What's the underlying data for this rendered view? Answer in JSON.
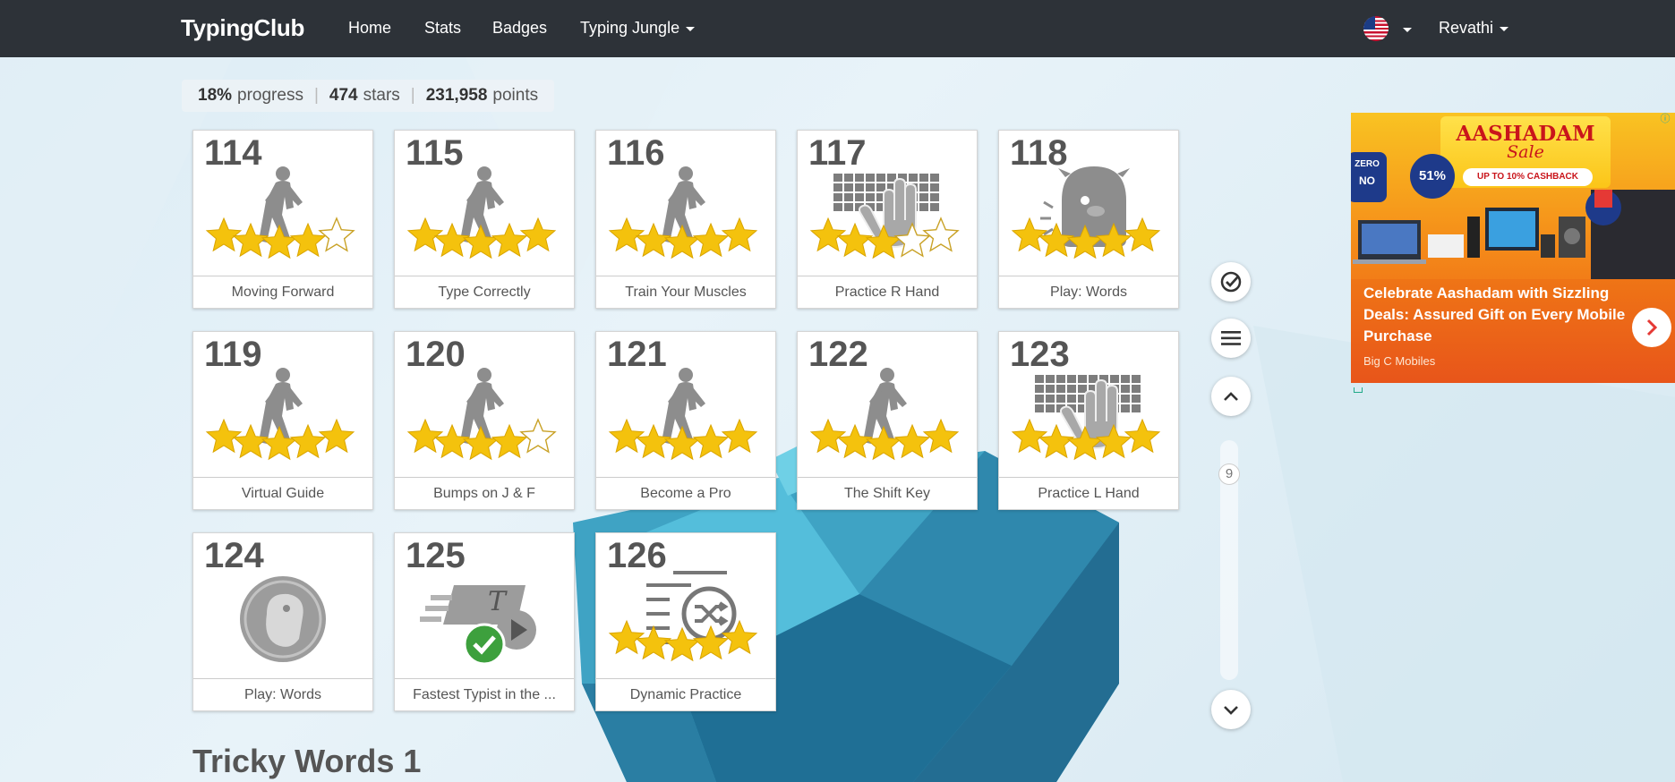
{
  "navbar": {
    "brand": "TypingClub",
    "links": [
      {
        "label": "Home"
      },
      {
        "label": "Stats"
      },
      {
        "label": "Badges"
      },
      {
        "label": "Typing Jungle"
      }
    ],
    "language_flag": "us-flag-icon",
    "user_name": "Revathi"
  },
  "progress": {
    "percent": "18%",
    "percent_label": "progress",
    "stars": "474",
    "stars_label": "stars",
    "points": "231,958",
    "points_label": "points"
  },
  "lessons": [
    {
      "number": "114",
      "title": "Moving Forward",
      "icon": "walker-icon",
      "stars": 4
    },
    {
      "number": "115",
      "title": "Type Correctly",
      "icon": "walker-icon",
      "stars": 5
    },
    {
      "number": "116",
      "title": "Train Your Muscles",
      "icon": "walker-icon",
      "stars": 5
    },
    {
      "number": "117",
      "title": "Practice R Hand",
      "icon": "keyboard-hand-icon",
      "stars": 3
    },
    {
      "number": "118",
      "title": "Play: Words",
      "icon": "monster-icon",
      "stars": 5
    },
    {
      "number": "119",
      "title": "Virtual Guide",
      "icon": "walker-icon",
      "stars": 5
    },
    {
      "number": "120",
      "title": "Bumps on J & F",
      "icon": "walker-icon",
      "stars": 4
    },
    {
      "number": "121",
      "title": "Become a Pro",
      "icon": "walker-icon",
      "stars": 5
    },
    {
      "number": "122",
      "title": "The Shift Key",
      "icon": "walker-icon",
      "stars": 5
    },
    {
      "number": "123",
      "title": "Practice L Hand",
      "icon": "keyboard-hand-icon",
      "stars": 5
    },
    {
      "number": "124",
      "title": "Play: Words",
      "icon": "game-badge-icon",
      "stars": 0
    },
    {
      "number": "125",
      "title": "Fastest Typist in the ...",
      "icon": "video-complete-icon",
      "stars": 0
    },
    {
      "number": "126",
      "title": "Dynamic Practice",
      "icon": "shuffle-lines-icon",
      "stars": 5
    }
  ],
  "side_controls": {
    "scroll_page": "9"
  },
  "ad": {
    "sale_title": "AASHADAM",
    "sale_subtitle": "Sale",
    "cashback": "UP TO 10% CASHBACK",
    "badge_zero": "ZERO",
    "badge_no": "NO",
    "badge_percent": "51%",
    "headline": "Celebrate Aashadam with Sizzling Deals: Assured Gift on Every Mobile Purchase",
    "sponsor": "Big C Mobiles"
  },
  "section": {
    "title": "Tricky Words 1"
  }
}
